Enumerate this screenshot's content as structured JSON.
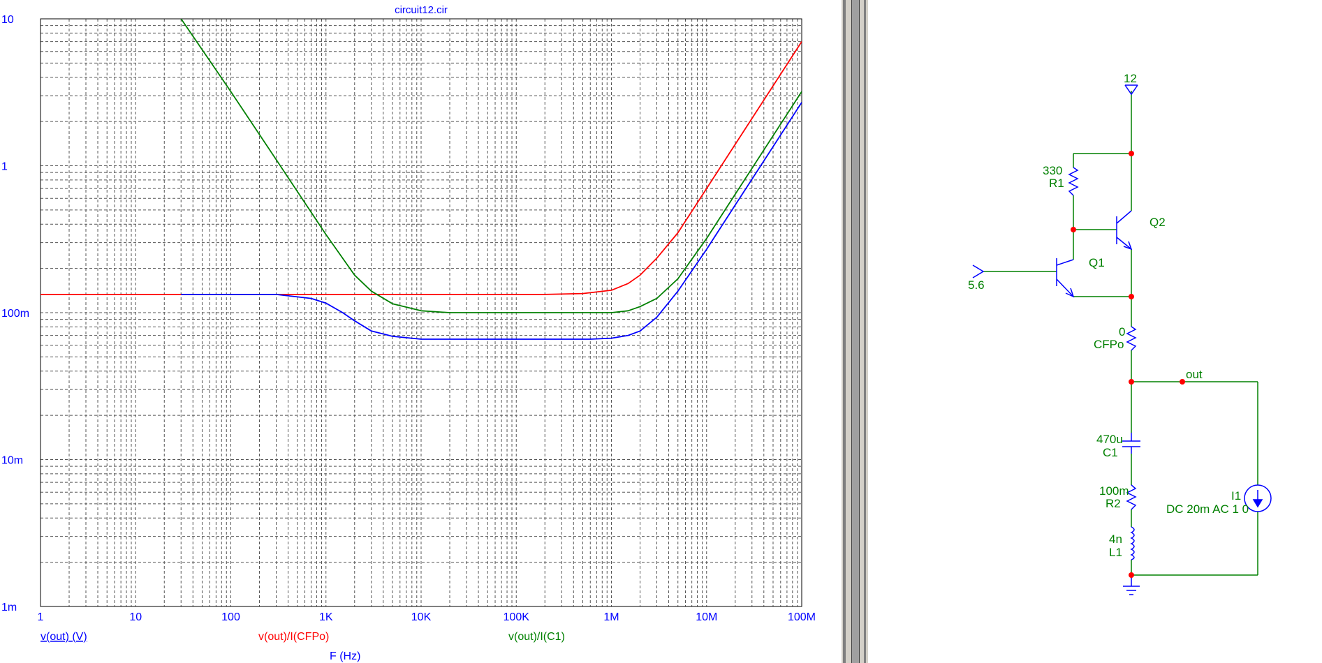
{
  "chart_data": {
    "type": "line",
    "title": "circuit12.cir",
    "xlabel": "F (Hz)",
    "x_scale": "log",
    "y_scale": "log",
    "xlim": [
      1,
      100000000
    ],
    "ylim": [
      0.001,
      10
    ],
    "x_ticks": [
      "1",
      "10",
      "100",
      "1K",
      "10K",
      "100K",
      "1M",
      "10M",
      "100M"
    ],
    "y_ticks": [
      "10",
      "1",
      "100m",
      "10m",
      "1m"
    ],
    "grid": true,
    "series": [
      {
        "name": "v(out) (V)",
        "color": "#0000ff",
        "x": [
          30,
          300,
          700,
          1000,
          1500,
          2000,
          3000,
          5000,
          10000,
          20000,
          50000,
          100000,
          300000,
          600000,
          1000000,
          1500000,
          2000000,
          3000000,
          5000000,
          10000000,
          20000000,
          50000000,
          100000000
        ],
        "y": [
          0.133,
          0.133,
          0.125,
          0.116,
          0.1,
          0.088,
          0.075,
          0.069,
          0.066,
          0.066,
          0.066,
          0.066,
          0.066,
          0.066,
          0.067,
          0.07,
          0.075,
          0.093,
          0.14,
          0.27,
          0.54,
          1.35,
          2.7
        ]
      },
      {
        "name": "v(out)/I(CFPo)",
        "color": "#ff0000",
        "x": [
          1,
          10,
          100,
          1000,
          10000,
          100000,
          200000,
          500000,
          1000000,
          1500000,
          2000000,
          3000000,
          5000000,
          10000000,
          20000000,
          50000000,
          100000000
        ],
        "y": [
          0.133,
          0.133,
          0.133,
          0.133,
          0.133,
          0.133,
          0.133,
          0.135,
          0.142,
          0.158,
          0.18,
          0.235,
          0.35,
          0.7,
          1.4,
          3.5,
          7
        ]
      },
      {
        "name": "v(out)/I(C1)",
        "color": "#008000",
        "x": [
          30,
          100,
          300,
          1000,
          2000,
          3000,
          5000,
          10000,
          20000,
          50000,
          100000,
          300000,
          1000000,
          1500000,
          2000000,
          3000000,
          5000000,
          10000000,
          20000000,
          50000000,
          100000000
        ],
        "y": [
          10,
          3.2,
          1.1,
          0.34,
          0.18,
          0.14,
          0.115,
          0.103,
          0.1,
          0.1,
          0.1,
          0.1,
          0.1,
          0.103,
          0.11,
          0.125,
          0.17,
          0.32,
          0.64,
          1.6,
          3.2
        ]
      }
    ]
  },
  "schematic": {
    "supply_label": "12",
    "r1_value": "330",
    "r1_name": "R1",
    "q2_label": "Q2",
    "q1_label": "Q1",
    "input_label": "5.6",
    "cfpo_value": "0",
    "cfpo_name": "CFPo",
    "out_label": "out",
    "c1_value": "470u",
    "c1_name": "C1",
    "r2_value": "100m",
    "r2_name": "R2",
    "l1_value": "4n",
    "l1_name": "L1",
    "i1_name": "I1",
    "i1_value": "DC 20m AC 1 0",
    "wire_color": "#008000",
    "component_color": "#0000ff",
    "node_color": "#ff0000"
  }
}
